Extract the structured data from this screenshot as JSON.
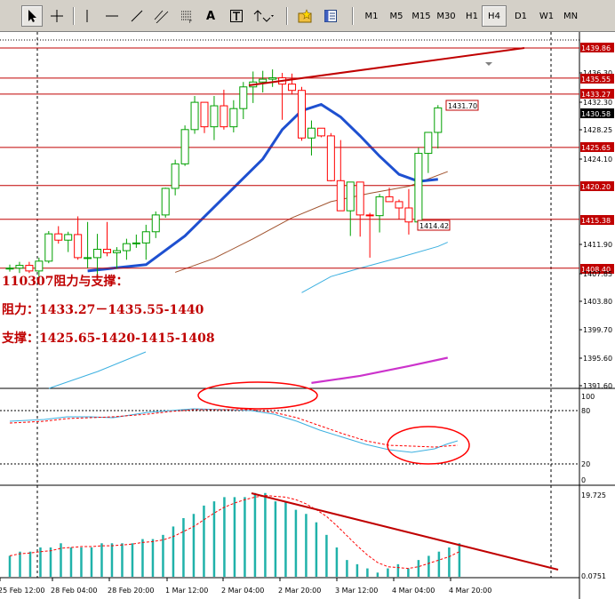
{
  "toolbar": {
    "tools": [
      {
        "name": "cursor-arrow-icon",
        "active": true
      },
      {
        "name": "crosshair-icon"
      },
      {
        "name": "vertical-line-icon"
      },
      {
        "name": "horizontal-line-icon"
      },
      {
        "name": "trendline-icon"
      },
      {
        "name": "channel-icon"
      },
      {
        "name": "fibonacci-icon"
      },
      {
        "name": "text-label-tool",
        "label": "A"
      },
      {
        "name": "text-box-icon"
      },
      {
        "name": "arrows-dropdown-icon"
      },
      {
        "name": "folder-star-icon"
      },
      {
        "name": "templates-icon"
      }
    ],
    "timeframes": [
      "M1",
      "M5",
      "M15",
      "M30",
      "H1",
      "H4",
      "D1",
      "W1",
      "MN"
    ],
    "active_timeframe": "H4"
  },
  "annotations": {
    "title": "110307阻力与支撑：",
    "resistance": "阻力：1433.27－1435.55-1440",
    "support": "支撑：1425.65-1420-1415-1408"
  },
  "price_axis": [
    "1439.86",
    "1436.30",
    "1435.55",
    "1433.27",
    "1432.30",
    "1430.58",
    "1428.25",
    "1425.65",
    "1424.10",
    "1420.20",
    "1415.38",
    "1411.90",
    "1408.40",
    "1407.85",
    "1403.80",
    "1399.70",
    "1395.60",
    "1391.60"
  ],
  "price_labels": {
    "high": "1431.70",
    "low": "1414.42"
  },
  "stoch_axis": [
    "100",
    "80",
    "20",
    "0"
  ],
  "volume_axis": [
    "19.725",
    "0.0751"
  ],
  "time_axis": [
    "25 Feb 12:00",
    "28 Feb 04:00",
    "28 Feb 20:00",
    "1 Mar 12:00",
    "2 Mar 04:00",
    "2 Mar 20:00",
    "3 Mar 12:00",
    "4 Mar 04:00",
    "4 Mar 20:00"
  ],
  "colors": {
    "bull": "#00a000",
    "bear": "#ff0000",
    "level": "#c00000",
    "ma_fast": "#1e50d0",
    "ma_mid": "#a0522d",
    "ma_slow": "#3cb0e0",
    "ma_long": "#cc33cc",
    "volume": "#20b2aa"
  },
  "chart_data": {
    "type": "candlestick",
    "candles": [
      [
        1408.4,
        1408.9,
        1407.9,
        1408.4
      ],
      [
        1408.4,
        1409.3,
        1407.7,
        1408.8
      ],
      [
        1408.8,
        1409.3,
        1407.7,
        1408.0
      ],
      [
        1408.0,
        1409.9,
        1407.2,
        1409.4
      ],
      [
        1409.4,
        1413.7,
        1409.1,
        1413.3
      ],
      [
        1413.3,
        1414.4,
        1411.9,
        1412.4
      ],
      [
        1412.4,
        1413.6,
        1410.7,
        1413.2
      ],
      [
        1413.2,
        1415.8,
        1409.6,
        1409.9
      ],
      [
        1409.9,
        1415.0,
        1408.4,
        1409.9
      ],
      [
        1409.9,
        1413.3,
        1406.7,
        1411.1
      ],
      [
        1411.1,
        1415.0,
        1410.1,
        1410.6
      ],
      [
        1410.6,
        1411.4,
        1408.3,
        1410.9
      ],
      [
        1410.9,
        1412.6,
        1409.6,
        1411.9
      ],
      [
        1411.9,
        1413.2,
        1411.3,
        1412.0
      ],
      [
        1412.0,
        1414.6,
        1409.6,
        1413.6
      ],
      [
        1413.6,
        1416.5,
        1412.7,
        1416.0
      ],
      [
        1416.0,
        1419.9,
        1415.6,
        1419.8
      ],
      [
        1419.8,
        1423.9,
        1418.8,
        1423.3
      ],
      [
        1423.3,
        1428.8,
        1423.0,
        1428.2
      ],
      [
        1428.2,
        1433.0,
        1427.6,
        1432.1
      ],
      [
        1432.1,
        1431.6,
        1427.7,
        1428.6
      ],
      [
        1428.6,
        1433.0,
        1426.7,
        1431.6
      ],
      [
        1431.6,
        1433.9,
        1428.2,
        1428.6
      ],
      [
        1428.6,
        1432.4,
        1427.8,
        1431.2
      ],
      [
        1431.2,
        1435.0,
        1429.7,
        1434.3
      ],
      [
        1434.3,
        1436.5,
        1432.0,
        1435.0
      ],
      [
        1435.0,
        1436.6,
        1433.5,
        1435.4
      ],
      [
        1435.4,
        1436.8,
        1434.3,
        1435.6
      ],
      [
        1435.6,
        1436.3,
        1429.6,
        1434.7
      ],
      [
        1434.7,
        1436.2,
        1433.2,
        1433.8
      ],
      [
        1433.8,
        1434.3,
        1426.6,
        1427.0
      ],
      [
        1427.0,
        1429.5,
        1424.5,
        1428.4
      ],
      [
        1428.4,
        1428.3,
        1427.1,
        1427.3
      ],
      [
        1427.3,
        1427.7,
        1420.8,
        1420.9
      ],
      [
        1420.9,
        1426.7,
        1417.2,
        1416.6
      ],
      [
        1416.6,
        1420.6,
        1413.0,
        1420.7
      ],
      [
        1420.7,
        1418.0,
        1412.9,
        1416.0
      ],
      [
        1416.0,
        1416.3,
        1409.9,
        1415.9
      ],
      [
        1415.9,
        1419.0,
        1413.5,
        1418.6
      ],
      [
        1418.6,
        1419.9,
        1418.1,
        1417.9
      ],
      [
        1417.9,
        1418.2,
        1415.4,
        1417.0
      ],
      [
        1417.0,
        1419.7,
        1413.2,
        1415.0
      ],
      [
        1415.0,
        1425.6,
        1414.4,
        1424.8
      ],
      [
        1424.8,
        1425.6,
        1422.0,
        1427.8
      ],
      [
        1427.8,
        1431.7,
        1425.5,
        1431.3
      ]
    ],
    "ma_fast": [
      [
        8,
        1408.0
      ],
      [
        14,
        1408.9
      ],
      [
        18,
        1413.0
      ],
      [
        22,
        1418.5
      ],
      [
        26,
        1424.0
      ],
      [
        28,
        1428.2
      ],
      [
        30,
        1430.9
      ],
      [
        32,
        1431.8
      ],
      [
        34,
        1430.0
      ],
      [
        36,
        1427.3
      ],
      [
        38,
        1424.4
      ],
      [
        40,
        1421.8
      ],
      [
        42,
        1420.8
      ],
      [
        44,
        1421.1
      ]
    ],
    "ma_mid": [
      [
        17,
        1407.8
      ],
      [
        21,
        1409.8
      ],
      [
        25,
        1412.6
      ],
      [
        29,
        1415.6
      ],
      [
        33,
        1417.9
      ],
      [
        37,
        1419.1
      ],
      [
        41,
        1420.1
      ],
      [
        45,
        1422.2
      ]
    ],
    "ma_slow": [
      [
        30,
        1404.9
      ],
      [
        33,
        1407.2
      ],
      [
        36,
        1408.4
      ],
      [
        40,
        1409.9
      ],
      [
        44,
        1411.5
      ],
      [
        45,
        1412.1
      ]
    ],
    "ma_long": [
      [
        31,
        1392.0
      ],
      [
        36,
        1393.0
      ],
      [
        41,
        1394.4
      ],
      [
        45,
        1395.6
      ]
    ],
    "levels": [
      1439.86,
      1435.55,
      1433.27,
      1425.65,
      1420.2,
      1415.38,
      1408.4
    ],
    "stochastic_main": [
      [
        0,
        68
      ],
      [
        3,
        70
      ],
      [
        5,
        73
      ],
      [
        7,
        73
      ],
      [
        9,
        72
      ],
      [
        12,
        78
      ],
      [
        14,
        80
      ],
      [
        16,
        82
      ],
      [
        19,
        81
      ],
      [
        21,
        80
      ],
      [
        23,
        76
      ],
      [
        25,
        68
      ],
      [
        27,
        58
      ],
      [
        29,
        50
      ],
      [
        31,
        42
      ],
      [
        33,
        36
      ],
      [
        35,
        33
      ],
      [
        37,
        37
      ],
      [
        38,
        42
      ],
      [
        39,
        46
      ]
    ],
    "stochastic_signal": [
      [
        0,
        66
      ],
      [
        3,
        68
      ],
      [
        5,
        71
      ],
      [
        7,
        72
      ],
      [
        9,
        73
      ],
      [
        12,
        76
      ],
      [
        14,
        79
      ],
      [
        16,
        81
      ],
      [
        19,
        81
      ],
      [
        21,
        81
      ],
      [
        23,
        78
      ],
      [
        25,
        72
      ],
      [
        27,
        63
      ],
      [
        29,
        54
      ],
      [
        31,
        46
      ],
      [
        33,
        41
      ],
      [
        35,
        40
      ],
      [
        37,
        39
      ],
      [
        38,
        40
      ],
      [
        39,
        41
      ]
    ],
    "volume": [
      5,
      6,
      6,
      7,
      7,
      8,
      7,
      7,
      7,
      8,
      8,
      8,
      8,
      9,
      9,
      10,
      12,
      14,
      15,
      17,
      18,
      19,
      19,
      19,
      20,
      20,
      18,
      18,
      16,
      15,
      13,
      10,
      7,
      4,
      3,
      2,
      1,
      2,
      3,
      2,
      4,
      5,
      6,
      7,
      8
    ]
  }
}
